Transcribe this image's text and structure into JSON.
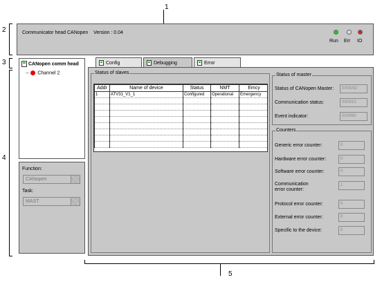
{
  "callouts": [
    "1",
    "2",
    "3",
    "4",
    "5"
  ],
  "header": {
    "title": "Communicator head CANopen    Version : 0.04",
    "leds": [
      {
        "label": "Run",
        "color": "#22cc22"
      },
      {
        "label": "Err",
        "color": "#dddddd"
      },
      {
        "label": "IO",
        "color": "#dd2222"
      }
    ]
  },
  "tree": {
    "root_label": "CANopen comm head",
    "child_label": "Channel 2"
  },
  "function_panel": {
    "function_label": "Function:",
    "function_value": "CANopen",
    "task_label": "Task:",
    "task_value": "MAST"
  },
  "tabs": [
    {
      "label": "Config",
      "active": false
    },
    {
      "label": "Debugging",
      "active": true
    },
    {
      "label": "Error",
      "active": false
    }
  ],
  "slaves": {
    "title": "Status of slaves",
    "columns": [
      "Addr",
      "Name of device",
      "Status",
      "NMT",
      "Emcy"
    ],
    "rows": [
      [
        "1",
        "ATV31_V1_1",
        "Configured",
        "Operational",
        "Emergency"
      ]
    ]
  },
  "master": {
    "title": "Status of master",
    "fields": [
      {
        "label": "Status of CANopen Master:",
        "value": "0X00AD"
      },
      {
        "label": "Communication status:",
        "value": "0X0010"
      },
      {
        "label": "Event indicator:",
        "value": "0X0080"
      }
    ]
  },
  "counters": {
    "title": "Counters",
    "fields": [
      {
        "label": "Generic error counter:",
        "value": "0"
      },
      {
        "label": "Hardware error counter:",
        "value": "0"
      },
      {
        "label": "Software error counter:",
        "value": "0"
      },
      {
        "label": "Communication error counter:",
        "value": "1"
      },
      {
        "label": "Protocol error counter:",
        "value": "0"
      },
      {
        "label": "External error counter:",
        "value": "0"
      },
      {
        "label": "Specific to the device:",
        "value": "0"
      }
    ]
  }
}
